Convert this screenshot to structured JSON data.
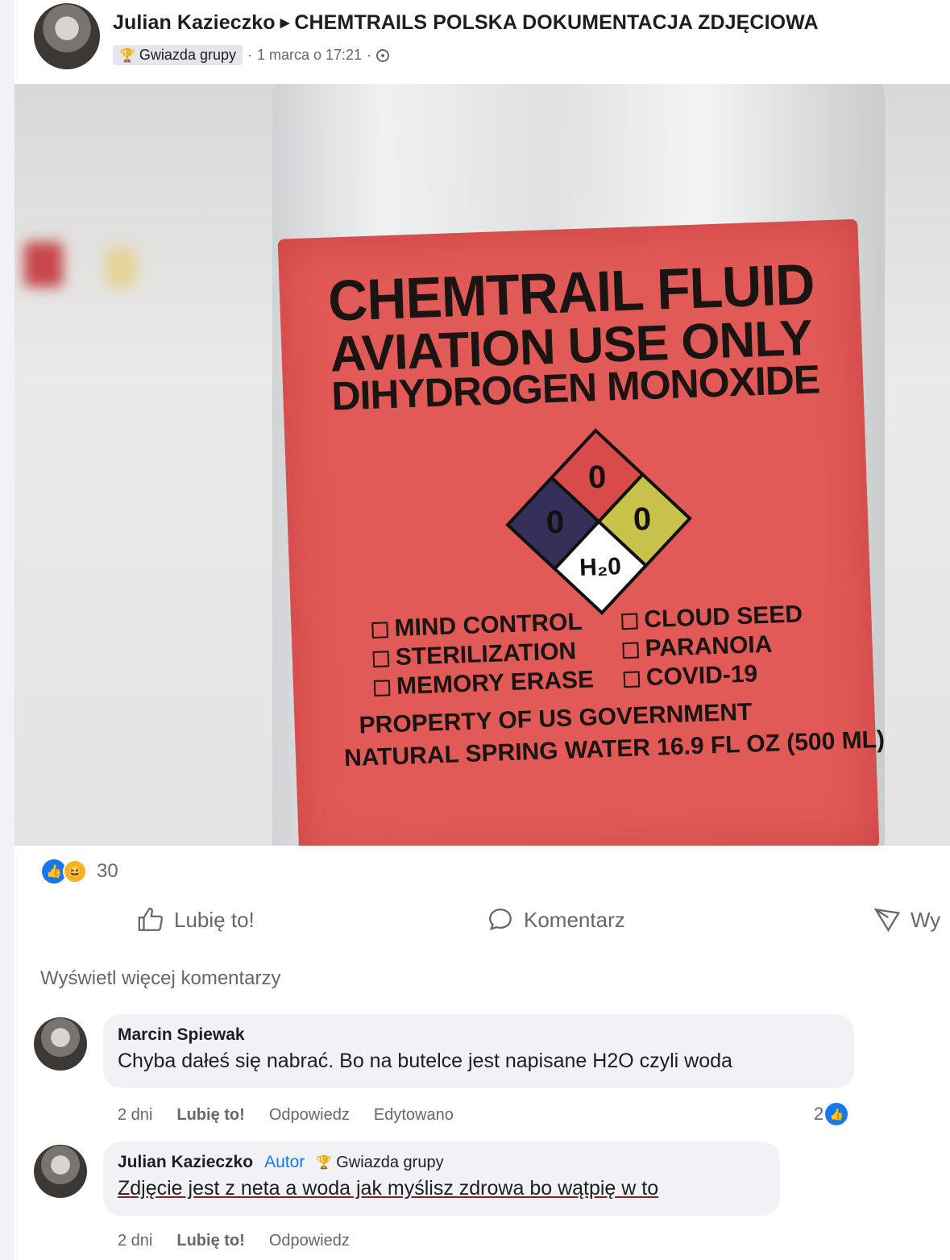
{
  "post": {
    "author": "Julian Kazieczko",
    "group": "CHEMTRAILS POLSKA DOKUMENTACJA ZDJĘCIOWA",
    "badge": "Gwiazda grupy",
    "time": "1 marca o 17:21",
    "separator": "·",
    "privacy_icon": "globe-icon"
  },
  "photo": {
    "label_line1": "CHEMTRAIL FLUID",
    "label_line2": "AVIATION USE ONLY",
    "label_line3": "DIHYDROGEN MONOXIDE",
    "diamond_top": "0",
    "diamond_left": "0",
    "diamond_right": "0",
    "diamond_bottom": "H₂0",
    "checks_left": [
      "MIND CONTROL",
      "STERILIZATION",
      "MEMORY ERASE"
    ],
    "checks_right": [
      "CLOUD SEED",
      "PARANOIA",
      "COVID-19"
    ],
    "label_line4": "PROPERTY OF US GOVERNMENT",
    "label_line5": "NATURAL SPRING WATER 16.9 FL OZ (500 ML)"
  },
  "reactions": {
    "count": "30",
    "icons": [
      "like-icon",
      "haha-icon"
    ]
  },
  "actions": {
    "like": "Lubię to!",
    "comment": "Komentarz",
    "share": "Wy"
  },
  "more_comments": "Wyświetl więcej komentarzy",
  "comments": [
    {
      "name": "Marcin Spiewak",
      "text": "Chyba dałeś się nabrać. Bo na butelce jest napisane H2O czyli woda",
      "time": "2 dni",
      "like": "Lubię to!",
      "reply": "Odpowiedz",
      "edited": "Edytowano",
      "reactions": "2"
    },
    {
      "name": "Julian Kazieczko",
      "role": "Autor",
      "badge": "Gwiazda grupy",
      "text": "Zdjęcie jest z neta a woda jak myślisz zdrowa bo wątpię w to",
      "time": "2 dni",
      "like": "Lubię to!",
      "reply": "Odpowiedz"
    }
  ],
  "colors": {
    "accent": "#1877f2",
    "label_red": "#e25a58",
    "muted": "#65676b"
  }
}
